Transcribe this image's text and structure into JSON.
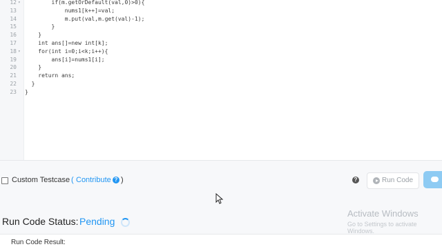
{
  "editor": {
    "lines": [
      {
        "num": "12",
        "fold": "▾",
        "text": "        if(m.getOrDefault(val,0)>0){"
      },
      {
        "num": "13",
        "fold": "",
        "text": "            nums1[k++]=val;"
      },
      {
        "num": "14",
        "fold": "",
        "text": "            m.put(val,m.get(val)-1);"
      },
      {
        "num": "15",
        "fold": "",
        "text": "        }"
      },
      {
        "num": "16",
        "fold": "",
        "text": "    }"
      },
      {
        "num": "17",
        "fold": "",
        "text": "    int ans[]=new int[k];"
      },
      {
        "num": "18",
        "fold": "▾",
        "text": "    for(int i=0;i<k;i++){"
      },
      {
        "num": "19",
        "fold": "",
        "text": "        ans[i]=nums1[i];"
      },
      {
        "num": "20",
        "fold": "",
        "text": "    }"
      },
      {
        "num": "21",
        "fold": "",
        "text": "    return ans;"
      },
      {
        "num": "22",
        "fold": "",
        "text": "  }"
      },
      {
        "num": "23",
        "fold": "",
        "text": "}"
      }
    ]
  },
  "testcase": {
    "label": "Custom Testcase",
    "paren_open": "(",
    "link": "Contribute",
    "paren_close": ")",
    "checked": false
  },
  "actions": {
    "help": "?",
    "run_label": "Run Code",
    "run_icon": "play-circle-icon",
    "submit_icon": "cloud-upload-icon"
  },
  "status": {
    "label": "Run Code Status:",
    "value": "Pending",
    "value_color": "#2196f3"
  },
  "result": {
    "title": "Run Code Result:"
  },
  "watermark": {
    "line1": "Activate Windows",
    "line2": "Go to Settings to activate Windows."
  }
}
